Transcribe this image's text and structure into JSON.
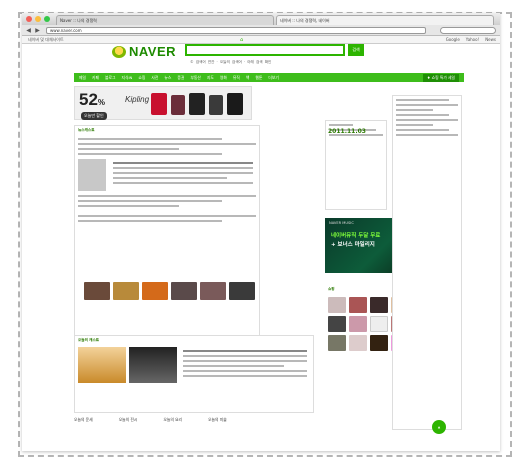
{
  "browser": {
    "tabs": [
      "Naver :: 나의 경쟁력",
      "네이버 :: 나의 경쟁력, 네이버"
    ],
    "url": "www.naver.com",
    "bookmarks": [
      "네이버 및 대체사이트"
    ],
    "bookmarks_right": [
      "Google",
      "Yahoo!",
      "News"
    ],
    "home_icon": "home-icon"
  },
  "naver": {
    "logo_text": "NAVER",
    "search_button_label": "검색",
    "search_placeholder": "",
    "subsearch_text": "© 검색어 연관 · 오늘의 검색어 · 아래 검색 확인",
    "gnb": [
      "메일",
      "카페",
      "블로그",
      "지식iN",
      "쇼핑",
      "사전",
      "뉴스",
      "증권",
      "부동산",
      "지도",
      "영화",
      "뮤직",
      "책",
      "웹툰",
      "더보기"
    ],
    "gnb_special": "♦ 쇼핑 특가 세일",
    "banner": {
      "percent": "52",
      "percent_suffix": "%",
      "badge": "오늘만 할인",
      "brand": "Kipling"
    },
    "news_header": "뉴스캐스트",
    "today_header": "오늘의 캐스트",
    "shopping_header": "쇼핑",
    "date": "2011.11.03",
    "promo": {
      "label": "NAVER MUSIC",
      "line1": "네이버뮤직 두달 무료",
      "line2": "+ 보너스 마일리지"
    },
    "bottom_tabs": [
      "오늘의 운세",
      "오늘의 전시",
      "오늘의 요리",
      "오늘의 미술"
    ]
  },
  "colors": {
    "naver_green": "#2db400",
    "gnb_green": "#3ebd1b"
  }
}
